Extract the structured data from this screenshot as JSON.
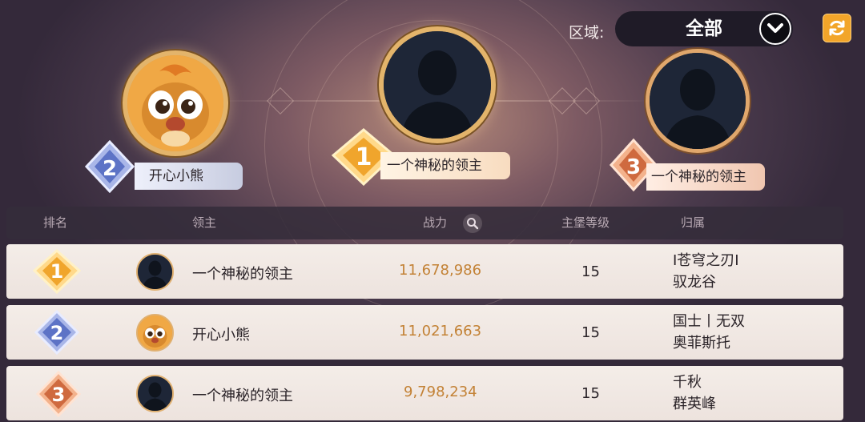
{
  "filter": {
    "region_label": "区域:",
    "region_value": "全部"
  },
  "icons": {
    "dropdown": "chevron-down-icon",
    "refresh": "refresh-icon",
    "search": "search-icon",
    "silhouette": "silhouette-icon",
    "bear": "bear-avatar-icon"
  },
  "colors": {
    "gold_medal": "#f2b13a",
    "silver_medal": "#6f86d6",
    "bronze_medal": "#d97a4e",
    "power_text": "#c38236",
    "refresh_button": "#f2a52a"
  },
  "podium": [
    {
      "rank": "1",
      "name": "一个神秘的领主"
    },
    {
      "rank": "2",
      "name": "开心小熊"
    },
    {
      "rank": "3",
      "name": "一个神秘的领主"
    }
  ],
  "table": {
    "headers": {
      "rank": "排名",
      "lord": "领主",
      "power": "战力",
      "castle_level": "主堡等级",
      "affiliation": "归属"
    },
    "rows": [
      {
        "rank": "1",
        "name": "一个神秘的领主",
        "power": "11,678,986",
        "level": "15",
        "affiliation_1": "I苍穹之刃I",
        "affiliation_2": "驭龙谷"
      },
      {
        "rank": "2",
        "name": "开心小熊",
        "power": "11,021,663",
        "level": "15",
        "affiliation_1": "国士丨无双",
        "affiliation_2": "奥菲斯托"
      },
      {
        "rank": "3",
        "name": "一个神秘的领主",
        "power": "9,798,234",
        "level": "15",
        "affiliation_1": "千秋",
        "affiliation_2": "群英峰"
      }
    ]
  }
}
